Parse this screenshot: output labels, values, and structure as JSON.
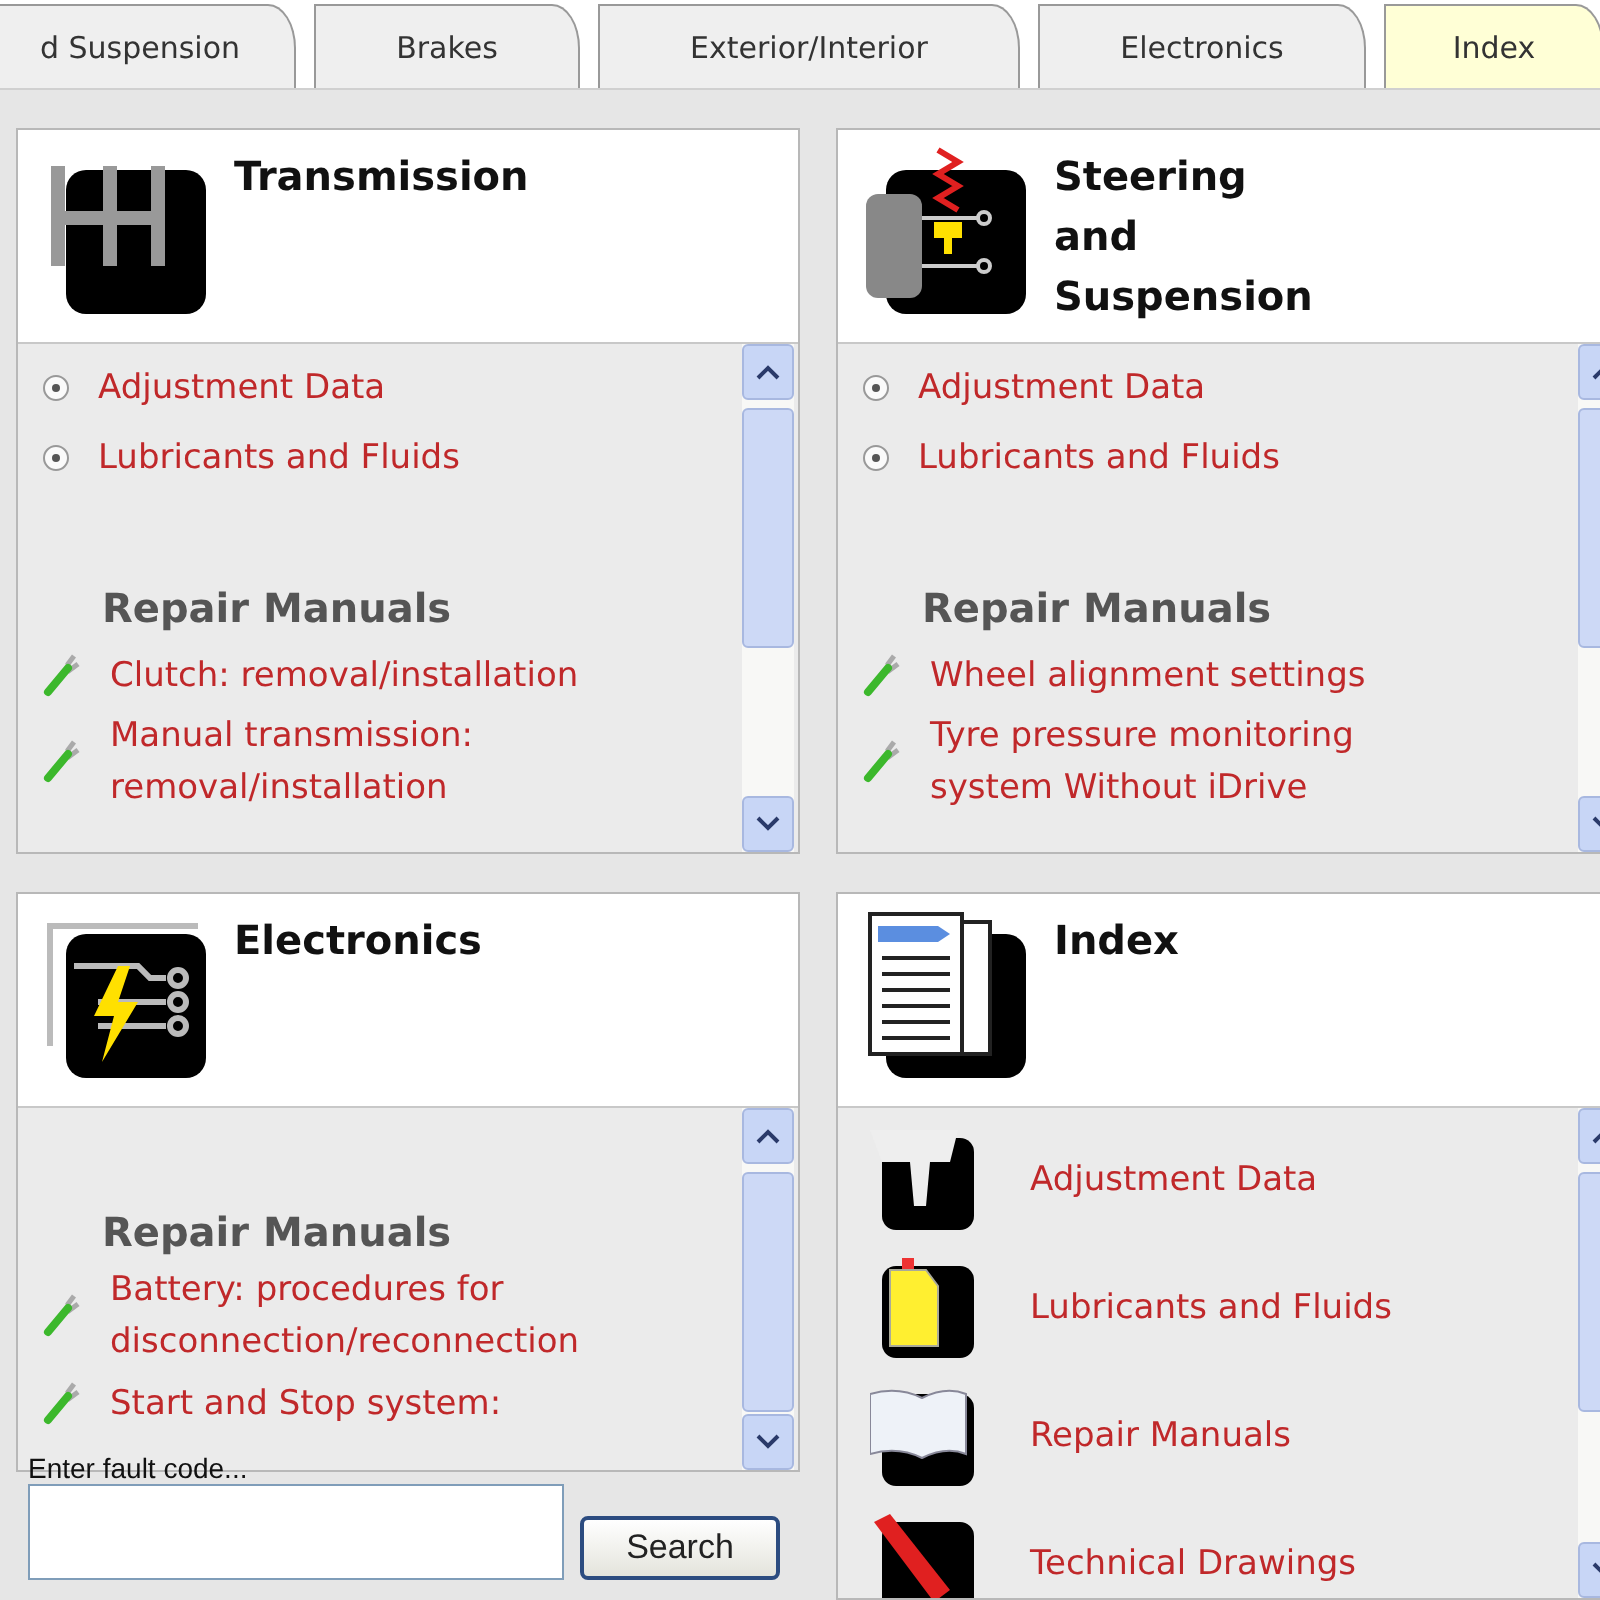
{
  "tabs": [
    {
      "label": "d Suspension",
      "selected": false
    },
    {
      "label": "Brakes",
      "selected": false
    },
    {
      "label": "Exterior/Interior",
      "selected": false
    },
    {
      "label": "Electronics",
      "selected": false
    },
    {
      "label": "Index",
      "selected": true
    }
  ],
  "panels": [
    {
      "kind": "transmission",
      "title": [
        "Transmission"
      ],
      "items": [
        {
          "kind": "link",
          "text": "Adjustment Data"
        },
        {
          "kind": "link",
          "text": "Lubricants and Fluids"
        },
        {
          "kind": "heading",
          "text": "Repair Manuals"
        },
        {
          "kind": "manual",
          "text": "Clutch: removal/installation"
        },
        {
          "kind": "manual",
          "text": "Manual transmission: removal/installation"
        }
      ]
    },
    {
      "kind": "steering",
      "title": [
        "Steering",
        "and",
        "Suspension"
      ],
      "items": [
        {
          "kind": "link",
          "text": "Adjustment Data"
        },
        {
          "kind": "link",
          "text": "Lubricants and Fluids"
        },
        {
          "kind": "heading",
          "text": "Repair Manuals"
        },
        {
          "kind": "manual",
          "text": "Wheel alignment settings"
        },
        {
          "kind": "manual",
          "text": "Tyre pressure monitoring system Without iDrive"
        }
      ]
    },
    {
      "kind": "electronics",
      "title": [
        "Electronics"
      ],
      "items": [
        {
          "kind": "heading",
          "text": "Repair Manuals"
        },
        {
          "kind": "manual",
          "text": "Battery: procedures for disconnection/reconnection"
        },
        {
          "kind": "manual",
          "text": "Start and Stop system:"
        }
      ]
    },
    {
      "kind": "index",
      "title": [
        "Index"
      ],
      "items": [
        {
          "kind": "adjustment",
          "text": "Adjustment Data"
        },
        {
          "kind": "lubricants",
          "text": "Lubricants and Fluids"
        },
        {
          "kind": "manuals",
          "text": "Repair Manuals"
        },
        {
          "kind": "drawings",
          "text": "Technical Drawings"
        }
      ]
    }
  ],
  "fault_search": {
    "label": "Enter fault code...",
    "button": "Search"
  }
}
